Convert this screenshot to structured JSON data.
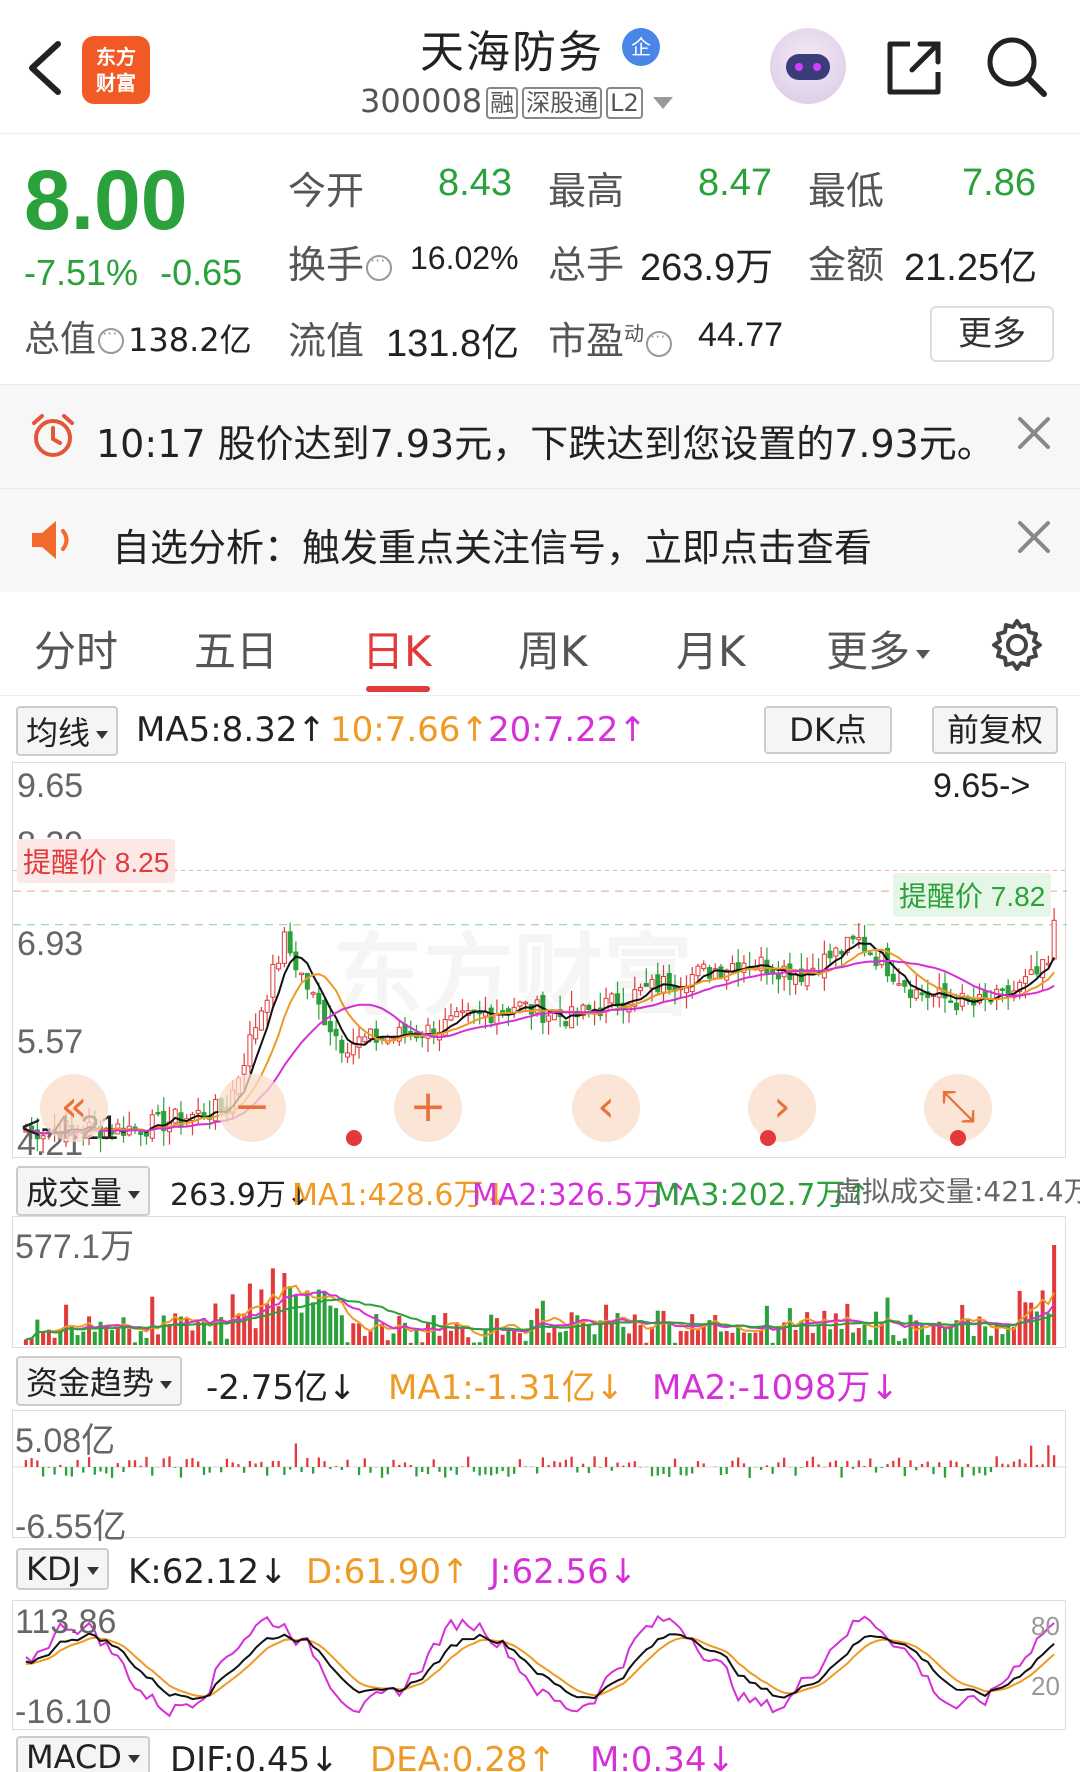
{
  "header": {
    "logo_line1": "东方",
    "logo_line2": "财富",
    "stock_name": "天海防务",
    "badge": "企",
    "code": "300008",
    "tags": [
      "融",
      "深股通",
      "L2"
    ]
  },
  "quote": {
    "price": "8.00",
    "change_pct": "-7.51%",
    "change_abs": "-0.65",
    "total_cap_label": "总值",
    "total_cap": "138.2亿",
    "open_label": "今开",
    "open": "8.43",
    "high_label": "最高",
    "high": "8.47",
    "low_label": "最低",
    "low": "7.86",
    "turnover_label": "换手",
    "turnover": "16.02%",
    "volume_label": "总手",
    "volume": "263.9万",
    "amount_label": "金额",
    "amount": "21.25亿",
    "float_cap_label": "流值",
    "float_cap": "131.8亿",
    "pe_label": "市盈",
    "pe_sup": "动",
    "pe": "44.77",
    "more_button": "更多"
  },
  "alerts": [
    {
      "text": "10:17 股价达到7.93元，下跌达到您设置的7.93元。"
    },
    {
      "text": "自选分析：触发重点关注信号，立即点击查看"
    }
  ],
  "tabs": [
    "分时",
    "五日",
    "日K",
    "周K",
    "月K",
    "更多"
  ],
  "active_tab": "日K",
  "ma_row": {
    "selector": "均线",
    "ma5": "MA5:8.32",
    "ma10": "10:7.66",
    "ma20": "20:7.22",
    "arrow_up": "↑",
    "dk_button": "DK点",
    "adjust_button": "前复权"
  },
  "kline": {
    "y_labels": [
      "9.65",
      "8.29",
      "6.93",
      "5.57",
      "4.21"
    ],
    "high_marker": "9.65->",
    "low_marker": "<-4.21",
    "alert_line_1": "提醒价 8.25",
    "alert_line_2": "提醒价 7.82",
    "watermark": "东方财富"
  },
  "nav_buttons": [
    "«",
    "−",
    "+",
    "‹",
    "›",
    "⤡"
  ],
  "volume_row": {
    "selector": "成交量",
    "value": "263.9万↓",
    "ma1": "MA1:428.6万↓",
    "ma2": "MA2:326.5万↑",
    "ma3": "MA3:202.7万↑",
    "virtual": "虚拟成交量:421.4万",
    "y_top": "577.1万"
  },
  "fund_row": {
    "selector": "资金趋势",
    "value": "-2.75亿↓",
    "ma1": "MA1:-1.31亿↓",
    "ma2": "MA2:-1098万↓",
    "y_top": "5.08亿",
    "y_bottom": "-6.55亿"
  },
  "kdj_row": {
    "selector": "KDJ",
    "k": "K:62.12↓",
    "d": "D:61.90↑",
    "j": "J:62.56↓",
    "y_top": "113.86",
    "y_bottom": "-16.10",
    "r80": "80",
    "r20": "20"
  },
  "macd_row": {
    "selector": "MACD",
    "dif": "DIF:0.45↓",
    "dea": "DEA:0.28↑",
    "m": "M:0.34↓"
  },
  "colors": {
    "up": "#e23a3a",
    "down": "#2aa13a",
    "ma5": "#111111",
    "ma10": "#ef9a25",
    "ma20": "#d630d8"
  }
}
